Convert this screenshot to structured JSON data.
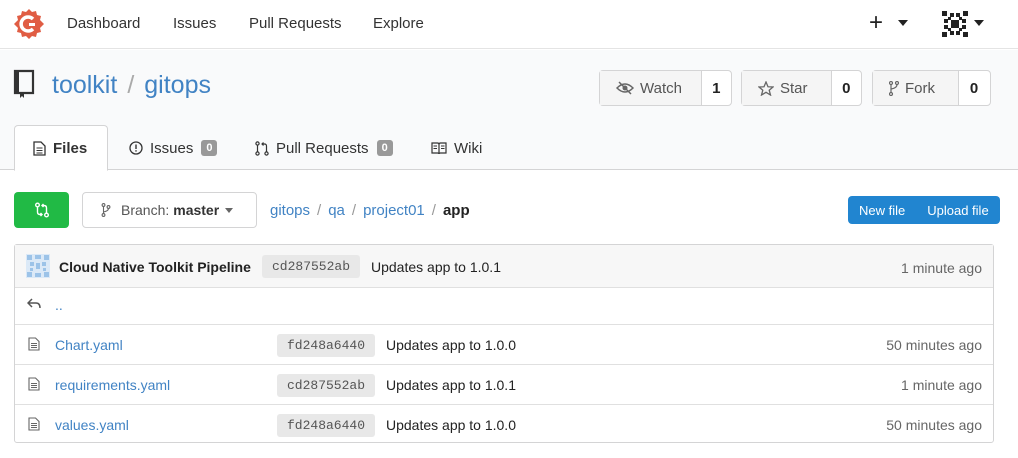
{
  "nav": {
    "items": [
      "Dashboard",
      "Issues",
      "Pull Requests",
      "Explore"
    ],
    "plus": "+"
  },
  "repo": {
    "owner": "toolkit",
    "separator": "/",
    "name": "gitops",
    "watch": {
      "label": "Watch",
      "count": "1"
    },
    "star": {
      "label": "Star",
      "count": "0"
    },
    "fork": {
      "label": "Fork",
      "count": "0"
    }
  },
  "tabs": [
    {
      "label": "Files",
      "icon": "file-text-icon",
      "active": true
    },
    {
      "label": "Issues",
      "icon": "issue-icon",
      "badge": "0"
    },
    {
      "label": "Pull Requests",
      "icon": "pull-request-icon",
      "badge": "0"
    },
    {
      "label": "Wiki",
      "icon": "book-icon"
    }
  ],
  "toolbar": {
    "branch_prefix": "Branch:",
    "branch": "master",
    "breadcrumb": [
      "gitops",
      "qa",
      "project01"
    ],
    "breadcrumb_current": "app",
    "new_file": "New file",
    "upload_file": "Upload file"
  },
  "latest_commit": {
    "author": "Cloud Native Toolkit Pipeline",
    "sha": "cd287552ab",
    "message": "Updates app to 1.0.1",
    "age": "1 minute ago"
  },
  "parent_dir": "..",
  "files": [
    {
      "name": "Chart.yaml",
      "sha": "fd248a6440",
      "message": "Updates app to 1.0.0",
      "age": "50 minutes ago"
    },
    {
      "name": "requirements.yaml",
      "sha": "cd287552ab",
      "message": "Updates app to 1.0.1",
      "age": "1 minute ago"
    },
    {
      "name": "values.yaml",
      "sha": "fd248a6440",
      "message": "Updates app to 1.0.0",
      "age": "50 minutes ago"
    }
  ],
  "colors": {
    "link": "#4183c4",
    "primary": "#2185d0",
    "success": "#21ba45",
    "logo": "#e05d44"
  }
}
